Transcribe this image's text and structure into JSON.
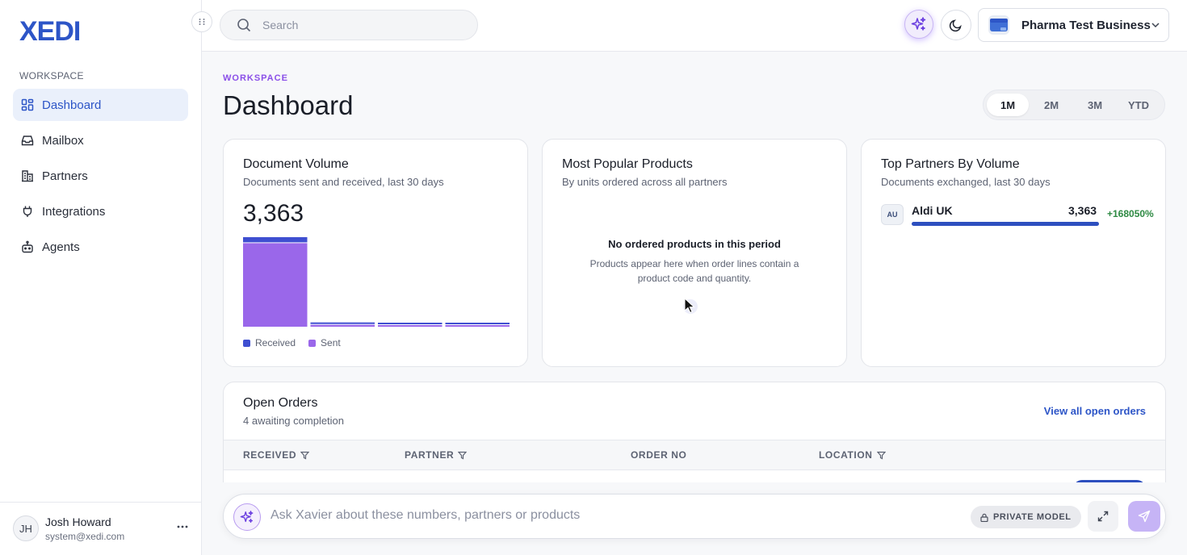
{
  "app": {
    "logo_text": "XEDI"
  },
  "sidebar": {
    "section_label": "WORKSPACE",
    "items": [
      {
        "label": "Dashboard",
        "icon": "grid-icon",
        "active": true
      },
      {
        "label": "Mailbox",
        "icon": "inbox-icon",
        "active": false
      },
      {
        "label": "Partners",
        "icon": "building-icon",
        "active": false
      },
      {
        "label": "Integrations",
        "icon": "plug-icon",
        "active": false
      },
      {
        "label": "Agents",
        "icon": "bot-icon",
        "active": false
      }
    ],
    "user": {
      "initials": "JH",
      "name": "Josh Howard",
      "email": "system@xedi.com"
    }
  },
  "topbar": {
    "search_placeholder": "Search",
    "business_name": "Pharma Test Business"
  },
  "main": {
    "eyebrow": "WORKSPACE",
    "title": "Dashboard",
    "ranges": [
      "1M",
      "2M",
      "3M",
      "YTD"
    ],
    "active_range": "1M"
  },
  "cards": {
    "document_volume": {
      "title": "Document Volume",
      "subtitle": "Documents sent and received, last 30 days",
      "total": "3,363",
      "legend": {
        "received": "Received",
        "sent": "Sent"
      }
    },
    "popular_products": {
      "title": "Most Popular Products",
      "subtitle": "By units ordered across all partners",
      "empty_title": "No ordered products in this period",
      "empty_desc": "Products appear here when order lines contain a product code and quantity."
    },
    "top_partners": {
      "title": "Top Partners By Volume",
      "subtitle": "Documents exchanged, last 30 days",
      "partners": [
        {
          "badge": "AU",
          "name": "Aldi UK",
          "count": "3,363",
          "delta": "+168050%",
          "share": 1.0
        }
      ]
    }
  },
  "chart_data": {
    "type": "bar",
    "stacked": true,
    "categories": [
      "",
      "",
      "",
      ""
    ],
    "series": [
      {
        "name": "Received",
        "values": [
          180,
          8,
          8,
          8
        ]
      },
      {
        "name": "Sent",
        "values": [
          2905,
          65,
          12,
          12
        ]
      }
    ],
    "colors": {
      "received": "#3f4fd1",
      "sent": "#9a67ea"
    }
  },
  "orders": {
    "title": "Open Orders",
    "subtitle": "4 awaiting completion",
    "link": "View all open orders",
    "columns": [
      "RECEIVED",
      "PARTNER",
      "ORDER NO",
      "LOCATION"
    ]
  },
  "ask": {
    "placeholder": "Ask Xavier about these numbers, partners or products",
    "private_label": "PRIVATE MODEL"
  },
  "colors": {
    "brand": "#2d55c7",
    "accent_purple": "#8a4fe8",
    "positive": "#2e8a43"
  }
}
